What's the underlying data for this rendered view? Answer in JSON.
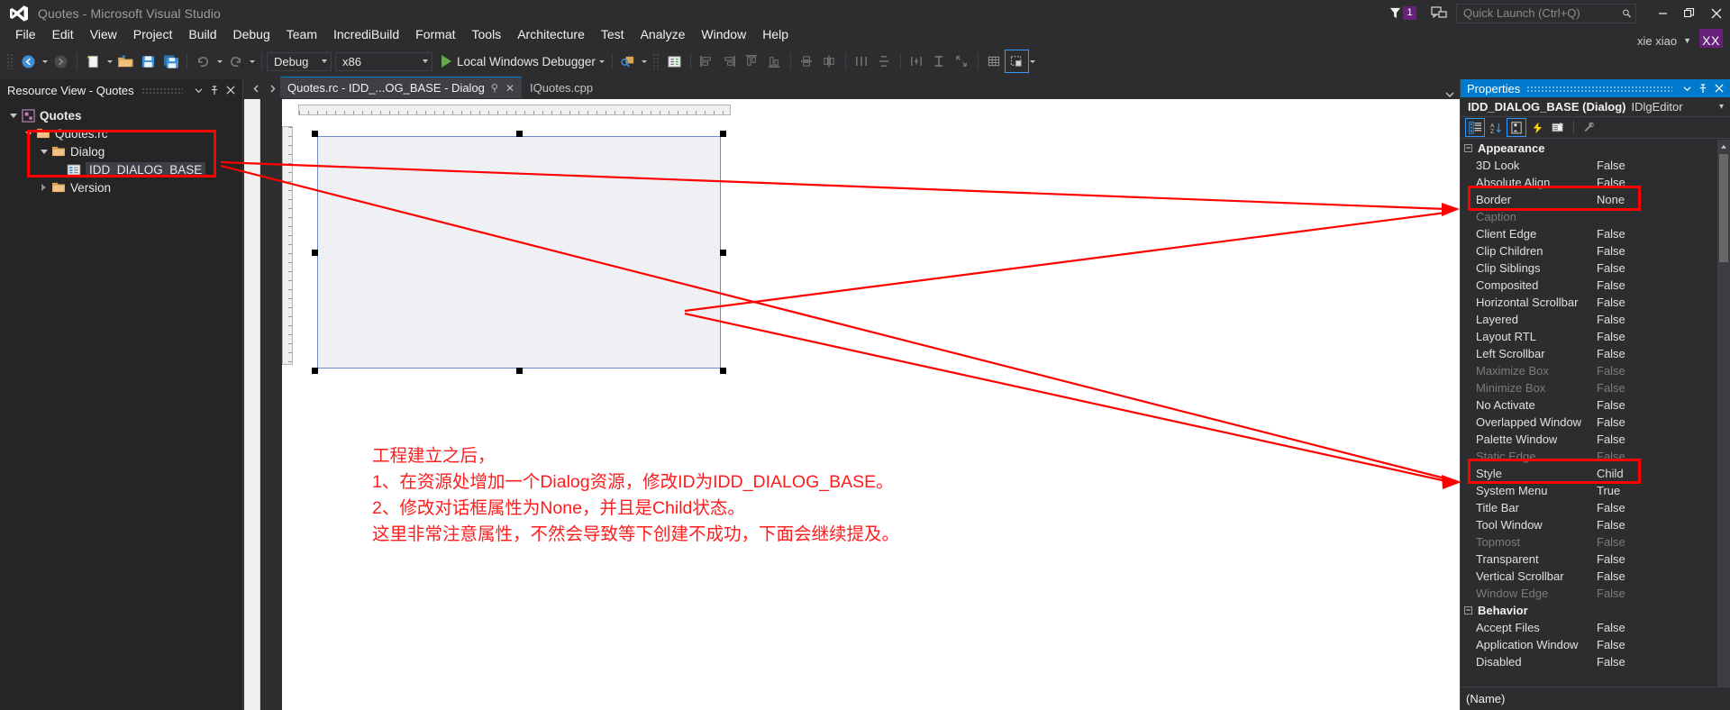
{
  "titlebar": {
    "app_title": "Quotes - Microsoft Visual Studio",
    "logo_icon": "visual-studio-logo",
    "notification_icon": "funnel-notification-icon",
    "notification_count": "1",
    "feedback_icon": "send-feedback-icon",
    "quick_launch_placeholder": "Quick Launch (Ctrl+Q)",
    "quick_launch_value": "",
    "search_icon": "search-icon",
    "minimize_icon": "minimize-icon",
    "restore_icon": "restore-icon",
    "close_icon": "close-icon"
  },
  "account": {
    "user_name": "xie xiao",
    "avatar_initials": "XX",
    "caret_icon": "chevron-down-icon"
  },
  "menubar": {
    "items": [
      {
        "label": "File"
      },
      {
        "label": "Edit"
      },
      {
        "label": "View"
      },
      {
        "label": "Project"
      },
      {
        "label": "Build"
      },
      {
        "label": "Debug"
      },
      {
        "label": "Team"
      },
      {
        "label": "IncrediBuild"
      },
      {
        "label": "Format"
      },
      {
        "label": "Tools"
      },
      {
        "label": "Architecture"
      },
      {
        "label": "Test"
      },
      {
        "label": "Analyze"
      },
      {
        "label": "Window"
      },
      {
        "label": "Help"
      }
    ]
  },
  "toolbar": {
    "nav_back_icon": "navigate-back-icon",
    "nav_forward_icon": "navigate-forward-icon",
    "new_item_icon": "new-item-icon",
    "open_file_icon": "open-file-icon",
    "save_icon": "save-icon",
    "save_all_icon": "save-all-icon",
    "undo_icon": "undo-icon",
    "redo_icon": "redo-icon",
    "config_value": "Debug",
    "platform_value": "x86",
    "run_label": "Local Windows Debugger",
    "run_icon": "play-icon",
    "find_icon": "find-in-files-icon",
    "props_window_icon": "properties-window-icon",
    "align_left_icon": "align-lefts-icon",
    "align_right_icon": "align-rights-icon",
    "align_top_icon": "align-tops-icon",
    "align_bottom_icon": "align-bottoms-icon",
    "center_vert_icon": "center-vertical-icon",
    "center_horiz_icon": "center-horizontal-icon",
    "space_across_icon": "space-across-icon",
    "space_down_icon": "space-down-icon",
    "toggle_guides_icon": "toggle-guides-icon",
    "test_dialog_icon": "test-dialog-icon",
    "size_to_content_icon": "size-to-content-icon",
    "tab_order_icon": "tab-order-icon",
    "dialog_grid_icon": "dialog-grid-icon",
    "overflow_icon": "toolbar-overflow-icon"
  },
  "doctabs": {
    "prev_icon": "tab-scroll-left-icon",
    "tabs": [
      {
        "label": "Quotes.rc - IDD_...OG_BASE - Dialog",
        "active": true,
        "pin_icon": "pin-icon",
        "close_icon": "close-icon"
      },
      {
        "label": "IQuotes.cpp",
        "active": false
      }
    ],
    "overflow_icon": "tab-list-icon"
  },
  "resource_view": {
    "title": "Resource View - Quotes",
    "menu_icon": "chevron-down-icon",
    "pin_icon": "auto-hide-pin-icon",
    "close_icon": "close-icon",
    "tree": [
      {
        "label": "Quotes",
        "depth": 0,
        "expanded": true,
        "icon": "project-icon",
        "bold": true,
        "selected": false
      },
      {
        "label": "Quotes.rc",
        "depth": 1,
        "expanded": true,
        "icon": "folder-icon",
        "bold": false,
        "selected": false
      },
      {
        "label": "Dialog",
        "depth": 2,
        "expanded": true,
        "icon": "folder-icon",
        "bold": false,
        "selected": false
      },
      {
        "label": "IDD_DIALOG_BASE",
        "depth": 3,
        "expanded": null,
        "icon": "dialog-res-icon",
        "bold": false,
        "selected": true
      },
      {
        "label": "Version",
        "depth": 2,
        "expanded": false,
        "icon": "folder-icon",
        "bold": false,
        "selected": false
      }
    ]
  },
  "annotation": {
    "color": "#ff1c1c",
    "lines": [
      "工程建立之后，",
      "1、在资源处增加一个Dialog资源，修改ID为IDD_DIALOG_BASE。",
      "2、修改对话框属性为None，并且是Child状态。",
      "这里非常注意属性，不然会导致等下创建不成功，下面会继续提及。"
    ]
  },
  "properties": {
    "title": "Properties",
    "menu_icon": "chevron-down-icon",
    "pin_icon": "auto-hide-pin-icon",
    "close_icon": "close-icon",
    "object_name": "IDD_DIALOG_BASE (Dialog)",
    "object_type": "IDlgEditor",
    "object_caret_icon": "chevron-down-icon",
    "tools": [
      {
        "name": "categorized-icon",
        "selected": true
      },
      {
        "name": "alphabetical-icon",
        "selected": false
      },
      {
        "name": "properties-page-icon",
        "selected": true
      },
      {
        "name": "events-icon",
        "selected": false
      },
      {
        "name": "messages-icon",
        "selected": false
      },
      {
        "name": "property-pages-icon",
        "selected": false
      }
    ],
    "groups": [
      {
        "name": "Appearance",
        "rows": [
          {
            "name": "3D Look",
            "value": "False",
            "dim": false
          },
          {
            "name": "Absolute Align",
            "value": "False",
            "dim": false
          },
          {
            "name": "Border",
            "value": "None",
            "dim": false,
            "highlight": true
          },
          {
            "name": "Caption",
            "value": "",
            "dim": true
          },
          {
            "name": "Client Edge",
            "value": "False",
            "dim": false
          },
          {
            "name": "Clip Children",
            "value": "False",
            "dim": false
          },
          {
            "name": "Clip Siblings",
            "value": "False",
            "dim": false
          },
          {
            "name": "Composited",
            "value": "False",
            "dim": false
          },
          {
            "name": "Horizontal Scrollbar",
            "value": "False",
            "dim": false
          },
          {
            "name": "Layered",
            "value": "False",
            "dim": false
          },
          {
            "name": "Layout RTL",
            "value": "False",
            "dim": false
          },
          {
            "name": "Left Scrollbar",
            "value": "False",
            "dim": false
          },
          {
            "name": "Maximize Box",
            "value": "False",
            "dim": true
          },
          {
            "name": "Minimize Box",
            "value": "False",
            "dim": true
          },
          {
            "name": "No Activate",
            "value": "False",
            "dim": false
          },
          {
            "name": "Overlapped Window",
            "value": "False",
            "dim": false
          },
          {
            "name": "Palette Window",
            "value": "False",
            "dim": false
          },
          {
            "name": "Static Edge",
            "value": "False",
            "dim": true
          },
          {
            "name": "Style",
            "value": "Child",
            "dim": false,
            "highlight": true
          },
          {
            "name": "System Menu",
            "value": "True",
            "dim": false
          },
          {
            "name": "Title Bar",
            "value": "False",
            "dim": false
          },
          {
            "name": "Tool Window",
            "value": "False",
            "dim": false
          },
          {
            "name": "Topmost",
            "value": "False",
            "dim": true
          },
          {
            "name": "Transparent",
            "value": "False",
            "dim": false
          },
          {
            "name": "Vertical Scrollbar",
            "value": "False",
            "dim": false
          },
          {
            "name": "Window Edge",
            "value": "False",
            "dim": true
          }
        ]
      },
      {
        "name": "Behavior",
        "rows": [
          {
            "name": "Accept Files",
            "value": "False",
            "dim": false
          },
          {
            "name": "Application Window",
            "value": "False",
            "dim": false
          },
          {
            "name": "Disabled",
            "value": "False",
            "dim": false
          }
        ]
      }
    ],
    "description_label": "(Name)",
    "scroll_up_icon": "scroll-up-icon",
    "scroll_down_icon": "scroll-down-icon"
  }
}
